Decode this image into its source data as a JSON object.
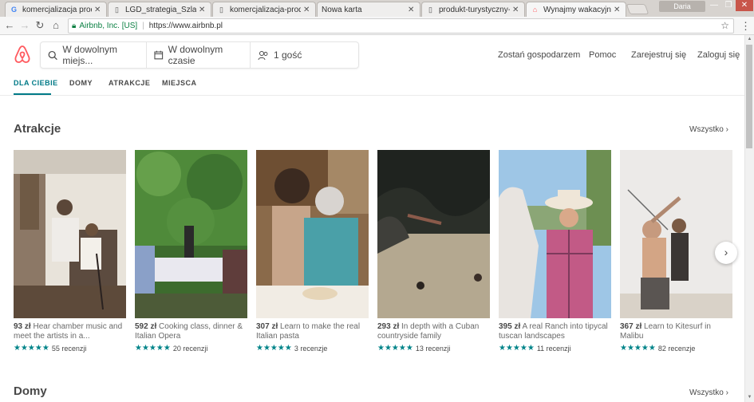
{
  "browser": {
    "tabs": [
      {
        "label": "komercjalizacja produk",
        "icon": "G"
      },
      {
        "label": "LGD_strategia_Szlak_Pi",
        "icon": "▯"
      },
      {
        "label": "komercjalizacja-produk",
        "icon": "▯"
      },
      {
        "label": "Nowa karta",
        "icon": ""
      },
      {
        "label": "produkt-turystyczny-w",
        "icon": "▯"
      },
      {
        "label": "Wynajmy wakacyjne, dr",
        "icon": "⌂"
      }
    ],
    "user": "Daria",
    "cert": "Airbnb, Inc. [US]",
    "url": "https://www.airbnb.pl"
  },
  "header": {
    "search_where": "W dowolnym miejs...",
    "search_when": "W dowolnym czasie",
    "search_guests": "1 gość",
    "nav": [
      "Zostań gospodarzem",
      "Pomoc",
      "Zarejestruj się",
      "Zaloguj się"
    ]
  },
  "tabs": [
    "DLA CIEBIE",
    "DOMY",
    "ATRAKCJE",
    "MIEJSCA"
  ],
  "attractions": {
    "title": "Atrakcje",
    "see_all": "Wszystko",
    "cards": [
      {
        "price": "93 zł",
        "text": "Hear chamber music and meet the artists in a...",
        "reviews": "55 recenzji"
      },
      {
        "price": "592 zł",
        "text": "Cooking class, dinner & Italian Opera",
        "reviews": "20 recenzji"
      },
      {
        "price": "307 zł",
        "text": "Learn to make the real Italian pasta",
        "reviews": "3 recenzje"
      },
      {
        "price": "293 zł",
        "text": "In depth with a Cuban countryside family",
        "reviews": "13 recenzji"
      },
      {
        "price": "395 zł",
        "text": "A real Ranch into tipycal tuscan landscapes",
        "reviews": "11 recenzji"
      },
      {
        "price": "367 zł",
        "text": "Learn to Kitesurf in Malibu",
        "reviews": "82 recenzje"
      }
    ]
  },
  "homes": {
    "title": "Domy",
    "see_all": "Wszystko"
  },
  "colors": {
    "brand": "#FF5A5F",
    "accent": "#007A87",
    "stars": "#008489"
  }
}
